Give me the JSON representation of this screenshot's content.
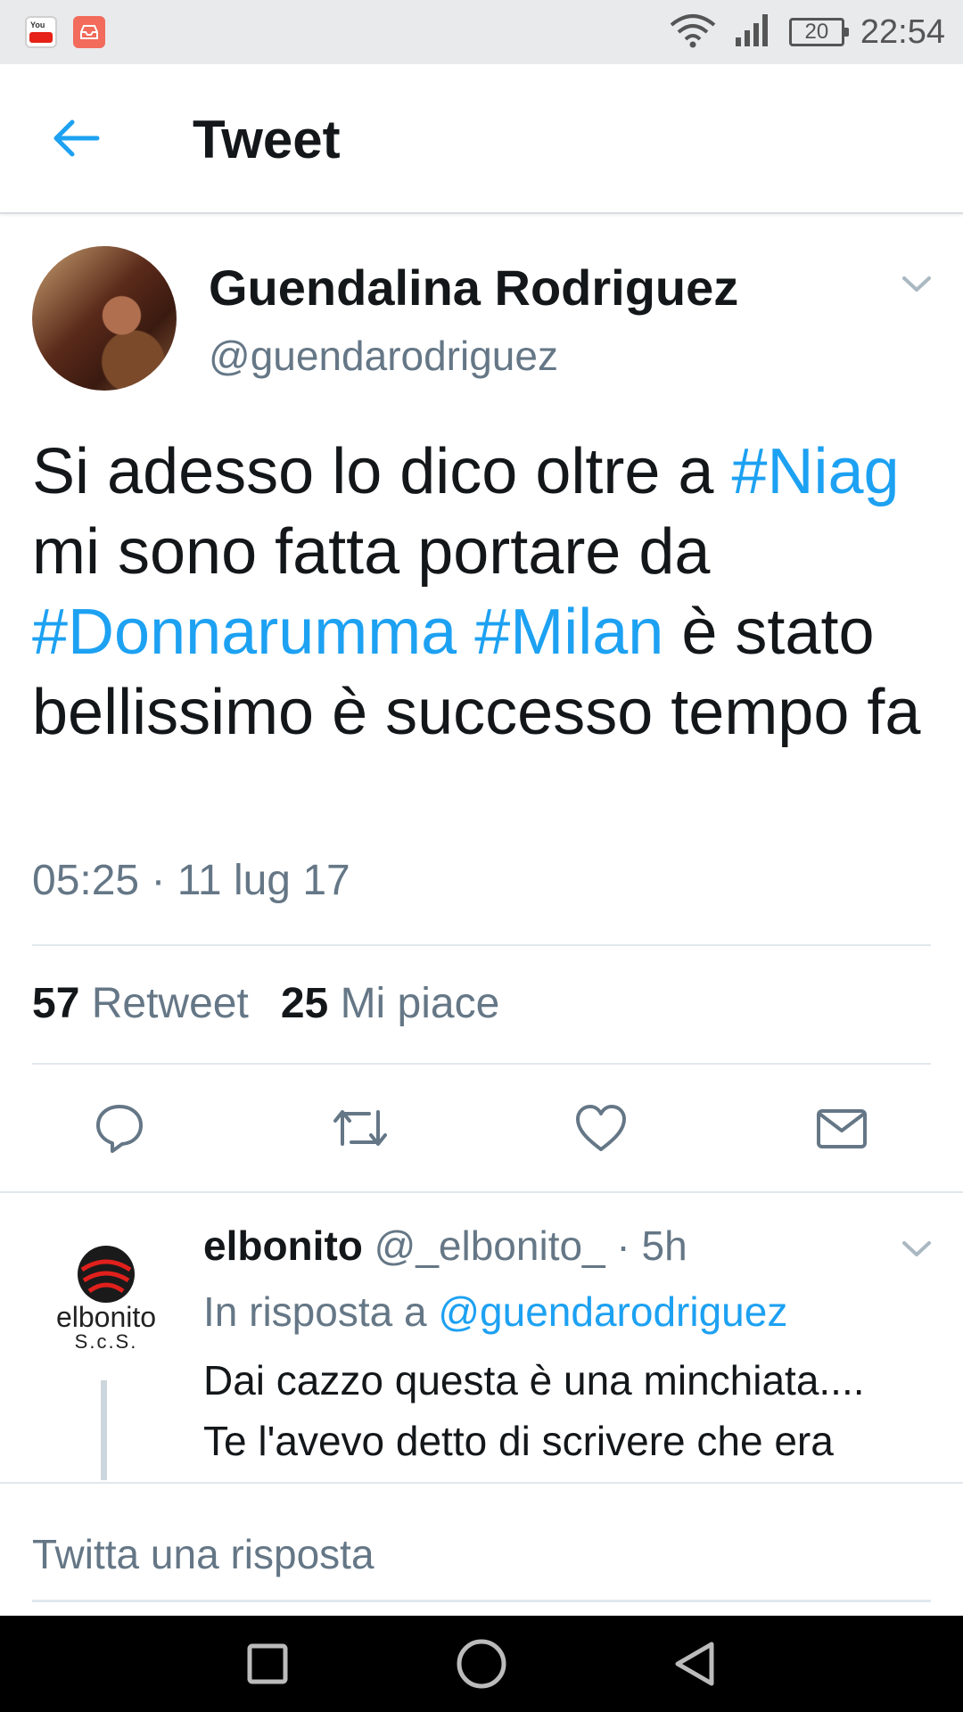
{
  "status_bar": {
    "battery": "20",
    "time": "22:54",
    "apps": [
      "youtube-icon",
      "inbox-icon"
    ]
  },
  "header": {
    "title": "Tweet"
  },
  "tweet": {
    "author_name": "Guendalina Rodriguez",
    "author_handle": "@guendarodriguez",
    "text_segments": [
      {
        "text": "Si adesso lo dico oltre a ",
        "type": "text"
      },
      {
        "text": "#Niag",
        "type": "hashtag"
      },
      {
        "text": " mi sono fatta portare da ",
        "type": "text"
      },
      {
        "text": "#Donnarumma",
        "type": "hashtag"
      },
      {
        "text": " ",
        "type": "text"
      },
      {
        "text": "#Milan",
        "type": "hashtag"
      },
      {
        "text": " è stato bellissimo è successo tempo fa",
        "type": "text"
      }
    ],
    "timestamp": "05:25 · 11 lug 17",
    "retweet_count": "57",
    "retweet_label": "Retweet",
    "like_count": "25",
    "like_label": "Mi piace"
  },
  "reply": {
    "author_name": "elbonito",
    "author_handle_time": "@_elbonito_ · 5h",
    "in_reply_prefix": "In risposta a ",
    "in_reply_handle": "@guendarodriguez",
    "text_line1": "Dai cazzo questa è una minchiata....",
    "text_line2": "Te l'avevo detto di scrivere che era",
    "avatar_logo_text": "elbonito",
    "avatar_logo_sub": "S.c.S."
  },
  "compose": {
    "placeholder": "Twitta una risposta"
  },
  "colors": {
    "accent": "#1da1f2",
    "secondary_text": "#657786",
    "primary_text": "#14171a"
  }
}
